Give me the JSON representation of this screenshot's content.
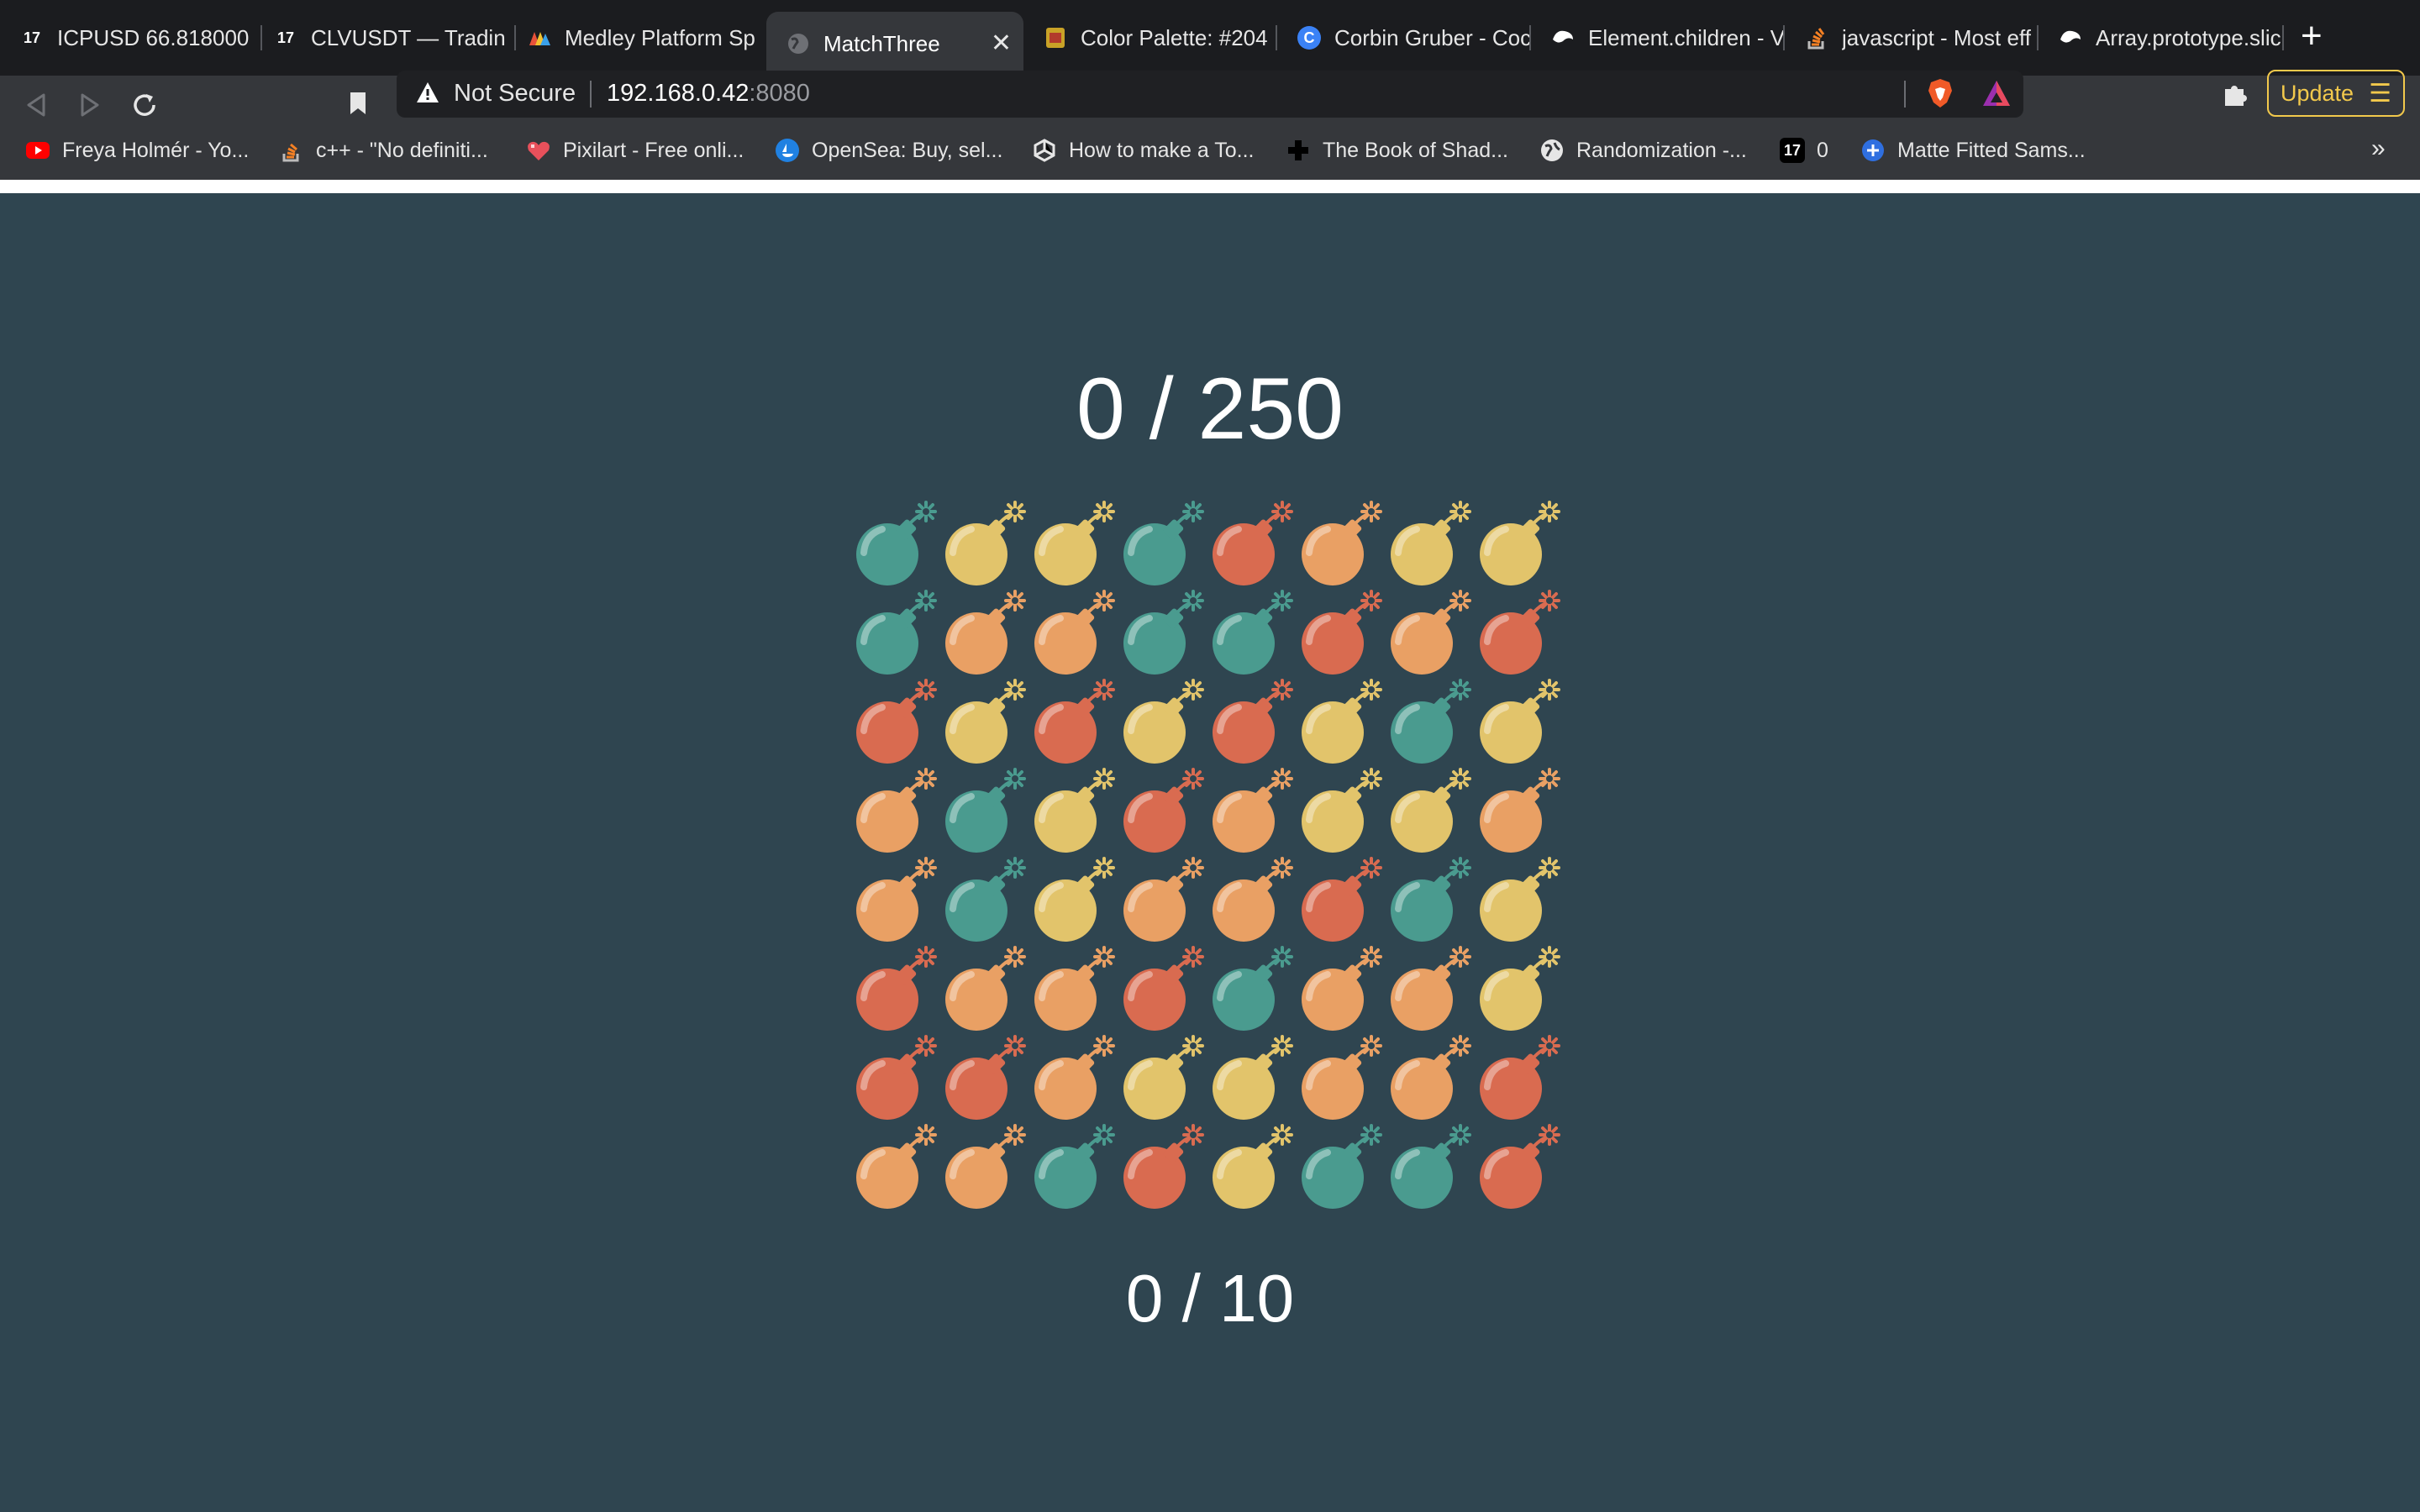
{
  "tabs": [
    {
      "title": "ICPUSD 66.818000",
      "favicon": "tradingview-icon",
      "active": false
    },
    {
      "title": "CLVUSDT — Trading",
      "favicon": "tradingview-icon",
      "active": false
    },
    {
      "title": "Medley Platform Sp",
      "favicon": "medley-icon",
      "active": false
    },
    {
      "title": "MatchThree",
      "favicon": "globe-icon",
      "active": true
    },
    {
      "title": "Color Palette: #204",
      "favicon": "palette-icon",
      "active": false
    },
    {
      "title": "Corbin Gruber - Coc",
      "favicon": "c-icon",
      "active": false
    },
    {
      "title": "Element.children - V",
      "favicon": "mdn-icon",
      "active": false
    },
    {
      "title": "javascript - Most eff",
      "favicon": "stackoverflow-icon",
      "active": false
    },
    {
      "title": "Array.prototype.slic",
      "favicon": "mdn-icon",
      "active": false
    }
  ],
  "address_bar": {
    "security_label": "Not Secure",
    "host": "192.168.0.42",
    "port": ":8080"
  },
  "toolbar": {
    "update_label": "Update"
  },
  "bookmarks": [
    {
      "label": "Freya Holmér - Yo...",
      "icon": "youtube-icon"
    },
    {
      "label": "c++ - \"No definiti...",
      "icon": "stackoverflow-icon"
    },
    {
      "label": "Pixilart - Free onli...",
      "icon": "pixilart-icon"
    },
    {
      "label": "OpenSea: Buy, sel...",
      "icon": "opensea-icon"
    },
    {
      "label": "How to make a To...",
      "icon": "unity-icon"
    },
    {
      "label": "The Book of Shad...",
      "icon": "plus-icon"
    },
    {
      "label": "Randomization -...",
      "icon": "globe-icon"
    },
    {
      "label": "0",
      "icon": "tradingview-icon"
    },
    {
      "label": "Matte Fitted Sams...",
      "icon": "circle-plus-icon"
    }
  ],
  "bookmarks_more": "»",
  "game": {
    "score_text": "0 / 250",
    "moves_text": "0 / 10",
    "colors": {
      "t": "#4a9b8f",
      "y": "#e2c46b",
      "o": "#e9a064",
      "r": "#d96b50"
    },
    "grid": [
      [
        "t",
        "y",
        "y",
        "t",
        "r",
        "o",
        "y",
        "y"
      ],
      [
        "t",
        "o",
        "o",
        "t",
        "t",
        "r",
        "o",
        "r"
      ],
      [
        "r",
        "y",
        "r",
        "y",
        "r",
        "y",
        "t",
        "y"
      ],
      [
        "o",
        "t",
        "y",
        "r",
        "o",
        "y",
        "y",
        "o"
      ],
      [
        "o",
        "t",
        "y",
        "o",
        "o",
        "r",
        "t",
        "y"
      ],
      [
        "r",
        "o",
        "o",
        "r",
        "t",
        "o",
        "o",
        "y"
      ],
      [
        "r",
        "r",
        "o",
        "y",
        "y",
        "o",
        "o",
        "r"
      ],
      [
        "o",
        "o",
        "t",
        "r",
        "y",
        "t",
        "t",
        "r"
      ]
    ]
  }
}
